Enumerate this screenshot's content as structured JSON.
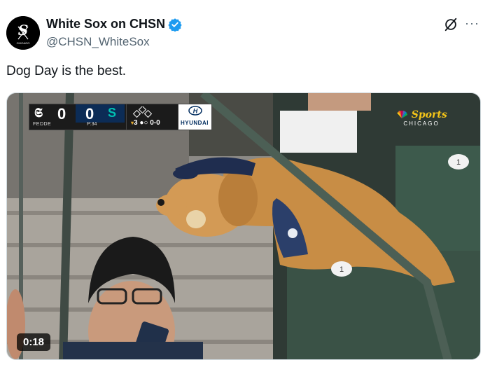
{
  "tweet": {
    "author": {
      "display_name": "White Sox on CHSN",
      "handle": "@CHSN_WhiteSox",
      "verified": true,
      "avatar_icon": "white-sox-logo-icon",
      "avatar_text": "CHICAGO"
    },
    "text": "Dog Day is the best.",
    "header_icons": [
      "grok-icon",
      "more-icon"
    ],
    "more_glyph": "···"
  },
  "media": {
    "type": "video",
    "duration": "0:18",
    "scorebug": {
      "away_logo": "𝕾",
      "away_score": "0",
      "home_score": "0",
      "home_logo": "S",
      "batter": "FEDDE",
      "pitch_count": "P:34",
      "inning_arrow": "▾",
      "inning": "3",
      "count": "0-0",
      "sponsor": "HYUNDAI"
    },
    "network": {
      "name": "Sports",
      "city": "CHICAGO"
    },
    "seat_numbers": [
      "1",
      "1"
    ]
  },
  "colors": {
    "verified_blue": "#1d9bf0",
    "handle_gray": "#536471",
    "mariners_navy": "#0c2c56",
    "mariners_teal": "#00c2b3",
    "nbc_gold": "#f5c518"
  }
}
